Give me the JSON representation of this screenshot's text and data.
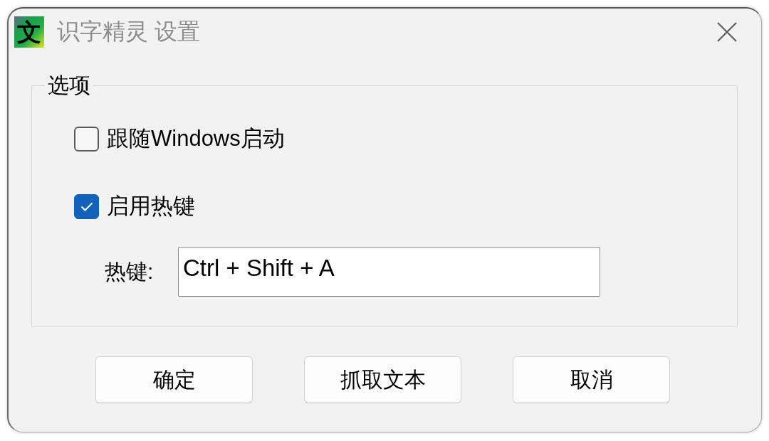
{
  "window": {
    "icon_glyph": "文",
    "title": "识字精灵 设置"
  },
  "options": {
    "legend": "选项",
    "checkboxes": [
      {
        "label": "跟随Windows启动",
        "checked": false
      },
      {
        "label": "启用热键",
        "checked": true
      }
    ],
    "hotkey": {
      "label": "热键:",
      "value": "Ctrl + Shift + A"
    }
  },
  "buttons": [
    "确定",
    "抓取文本",
    "取消"
  ]
}
